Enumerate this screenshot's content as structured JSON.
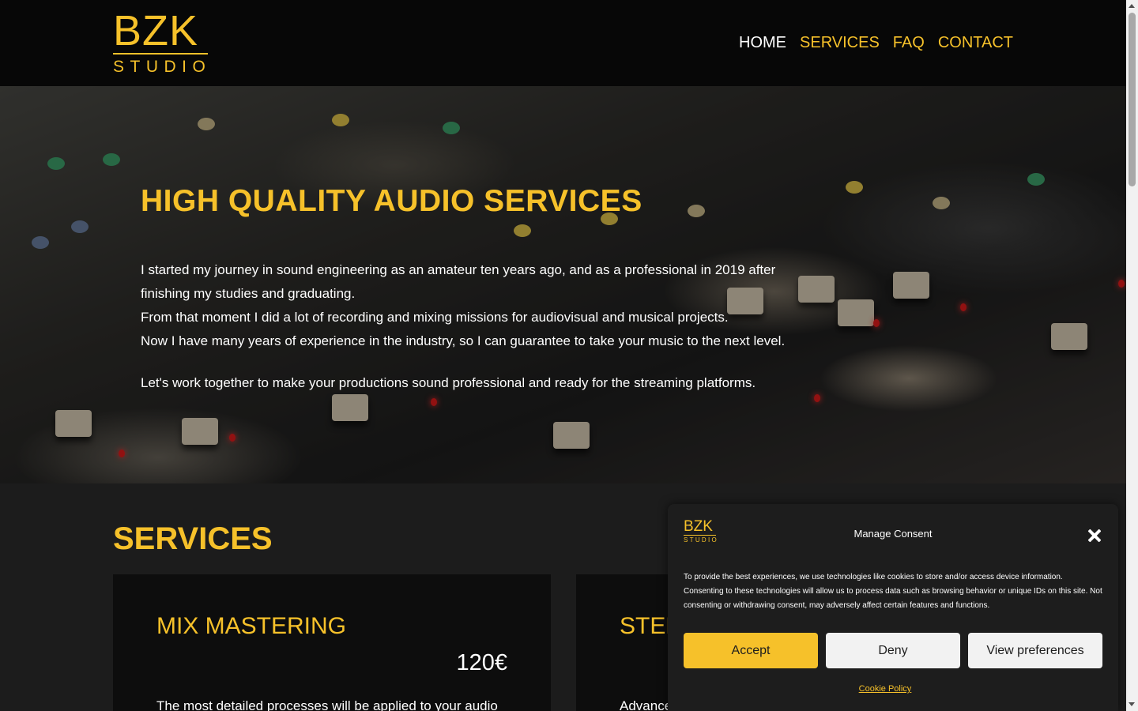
{
  "logo": {
    "brand": "BZK",
    "sub": "STUDIO"
  },
  "nav": [
    {
      "label": "HOME"
    },
    {
      "label": "SERVICES"
    },
    {
      "label": "FAQ"
    },
    {
      "label": "CONTACT"
    }
  ],
  "hero": {
    "title": "HIGH QUALITY AUDIO SERVICES",
    "lines": [
      "I started my journey in sound engineering as an amateur ten years ago, and as a professional in 2019 after finishing my studies and graduating.",
      "From that moment I did a lot of recording and mixing missions for audiovisual and musical projects.",
      "Now I have many years of experience in the industry, so I can guarantee to take your music to the next level.",
      "Let's work together to make your productions sound professional and ready for the streaming platforms."
    ]
  },
  "services": {
    "title": "SERVICES",
    "cards": [
      {
        "title": "MIX MASTERING",
        "price": "120€",
        "desc": "The most detailed processes will be applied to your audio"
      },
      {
        "title": "STEM",
        "price": "",
        "desc": "Advanced"
      }
    ]
  },
  "consent": {
    "logo_brand": "BZK",
    "logo_sub": "STUDIO",
    "title": "Manage Consent",
    "text": "To provide the best experiences, we use technologies like cookies to store and/or access device information. Consenting to these technologies will allow us to process data such as browsing behavior or unique IDs on this site. Not consenting or withdrawing consent, may adversely affect certain features and functions.",
    "accept": "Accept",
    "deny": "Deny",
    "preferences": "View preferences",
    "policy": "Cookie Policy"
  },
  "colors": {
    "accent": "#f6c12a",
    "header_bg": "#070707",
    "page_bg": "#1c1c1c",
    "card_bg": "#0d0d0d"
  }
}
